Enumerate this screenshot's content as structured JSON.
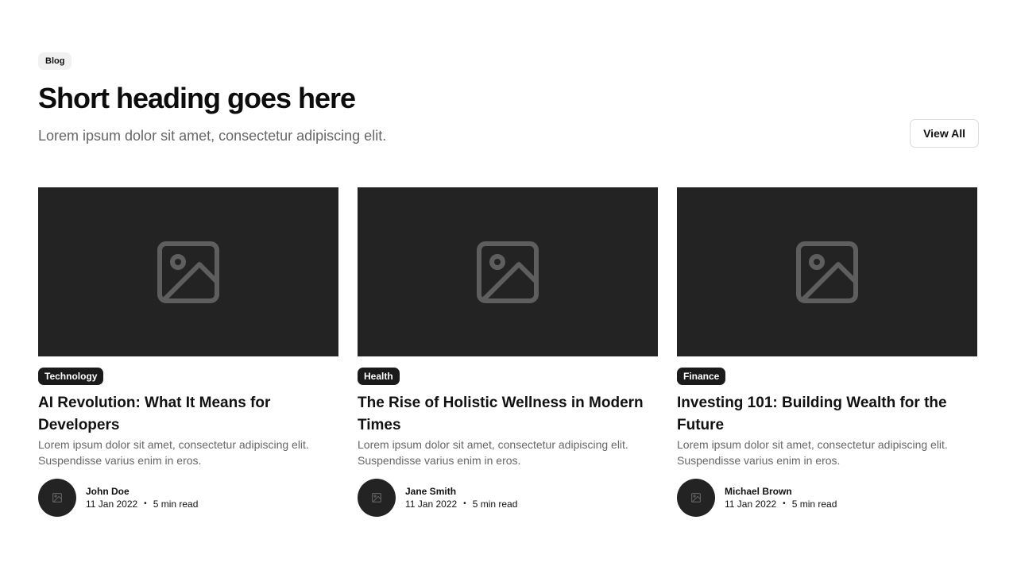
{
  "header": {
    "tag": "Blog",
    "title": "Short heading goes here",
    "subtitle": "Lorem ipsum dolor sit amet, consectetur adipiscing elit.",
    "view_all_label": "View All"
  },
  "icons": {
    "thumbnail": "image-placeholder-icon",
    "avatar": "image-placeholder-icon"
  },
  "colors": {
    "placeholder_bg": "#232323",
    "placeholder_icon": "#5e5e5e",
    "category_bg": "#1b1b1b",
    "muted_text": "#666666"
  },
  "posts": [
    {
      "category": "Technology",
      "title": "AI Revolution: What It Means for Developers",
      "excerpt": "Lorem ipsum dolor sit amet, consectetur adipiscing elit. Suspendisse varius enim in eros.",
      "author": "John Doe",
      "date": "11 Jan 2022",
      "separator": "•",
      "read_time": "5 min read"
    },
    {
      "category": "Health",
      "title": "The Rise of Holistic Wellness in Modern Times",
      "excerpt": "Lorem ipsum dolor sit amet, consectetur adipiscing elit. Suspendisse varius enim in eros.",
      "author": "Jane Smith",
      "date": "11 Jan 2022",
      "separator": "•",
      "read_time": "5 min read"
    },
    {
      "category": "Finance",
      "title": "Investing 101: Building Wealth for the Future",
      "excerpt": "Lorem ipsum dolor sit amet, consectetur adipiscing elit. Suspendisse varius enim in eros.",
      "author": "Michael Brown",
      "date": "11 Jan 2022",
      "separator": "•",
      "read_time": "5 min read"
    }
  ]
}
